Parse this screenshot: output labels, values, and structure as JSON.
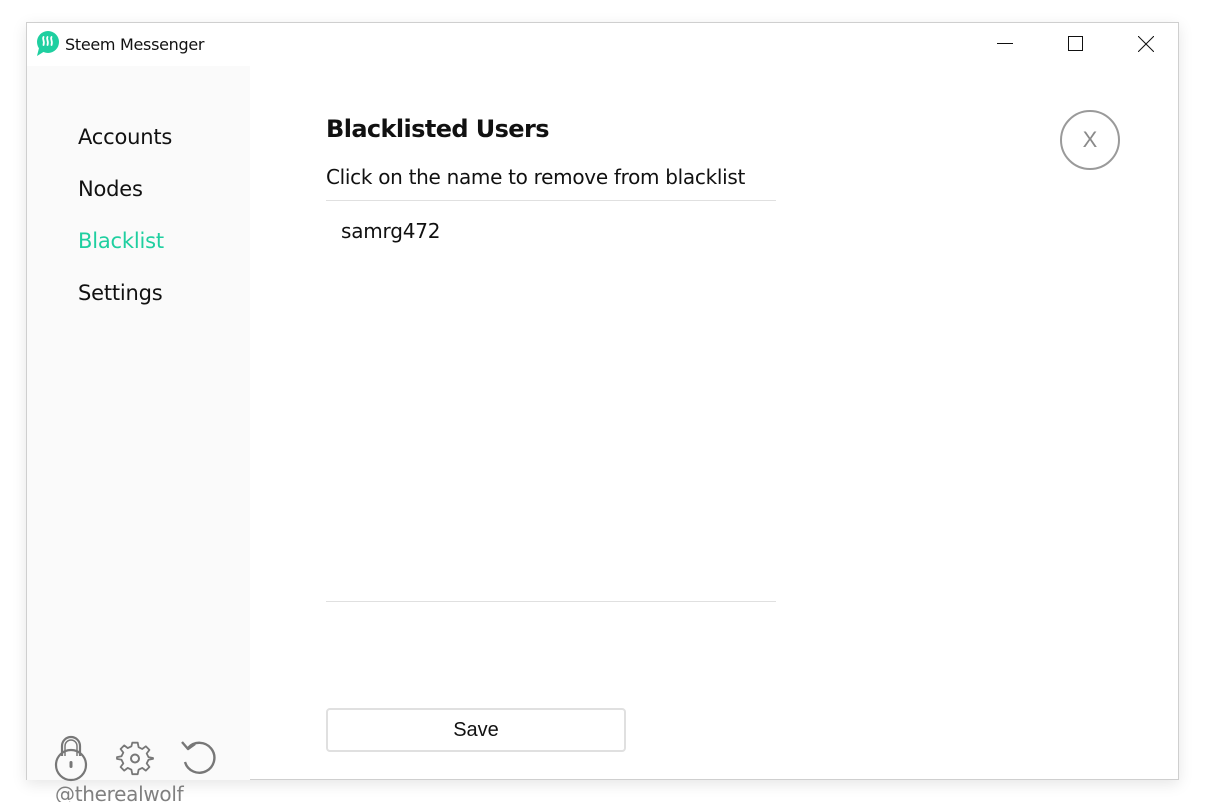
{
  "window": {
    "title": "Steem Messenger",
    "controls": [
      "minimize",
      "maximize",
      "close"
    ]
  },
  "colors": {
    "accent": "#1fcfa0",
    "sidebar_bg": "#fafafa",
    "muted": "#808080"
  },
  "sidebar": {
    "items": [
      {
        "label": "Accounts",
        "active": false
      },
      {
        "label": "Nodes",
        "active": false
      },
      {
        "label": "Blacklist",
        "active": true
      },
      {
        "label": "Settings",
        "active": false
      }
    ],
    "footer_icons": [
      "lock-icon",
      "gear-icon",
      "refresh-icon"
    ],
    "username": "@therealwolf"
  },
  "main": {
    "title": "Blacklisted Users",
    "subtitle": "Click on the name to remove from blacklist",
    "blacklist": [
      "samrg472"
    ],
    "close_label": "X",
    "save_label": "Save"
  }
}
